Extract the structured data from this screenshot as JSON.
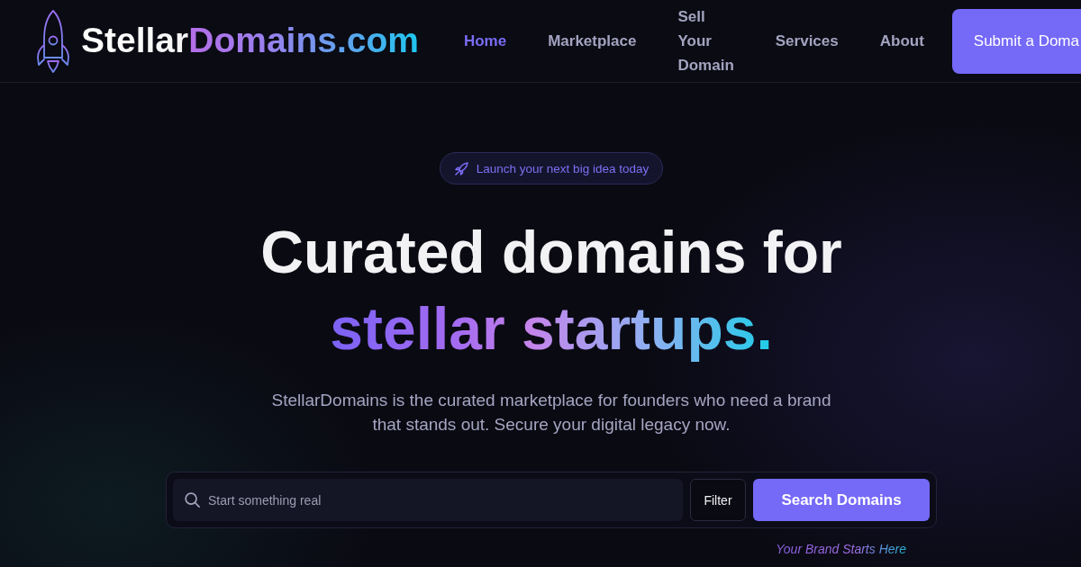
{
  "header": {
    "logo": {
      "text": "StellarDomains.com"
    },
    "nav": [
      {
        "label": "Home",
        "selected": true
      },
      {
        "label": "Marketplace",
        "selected": false
      },
      {
        "label": "Sell Your Domain",
        "selected": false
      },
      {
        "label": "Services",
        "selected": false
      },
      {
        "label": "About",
        "selected": false
      }
    ],
    "cta_button": {
      "label": "Submit a Doma"
    }
  },
  "hero": {
    "badge": {
      "text": "Launch your next big idea today"
    },
    "headline": "Curated domains for",
    "headline_accent": "stellar startups.",
    "description": "StellarDomains is the curated marketplace for founders who need a brand that stands out. Secure your digital legacy now.",
    "search": {
      "placeholder": "Start something real",
      "filter_button": "Filter",
      "submit_button": "Search Domains"
    },
    "tagline": "Your Brand Starts Here"
  }
}
